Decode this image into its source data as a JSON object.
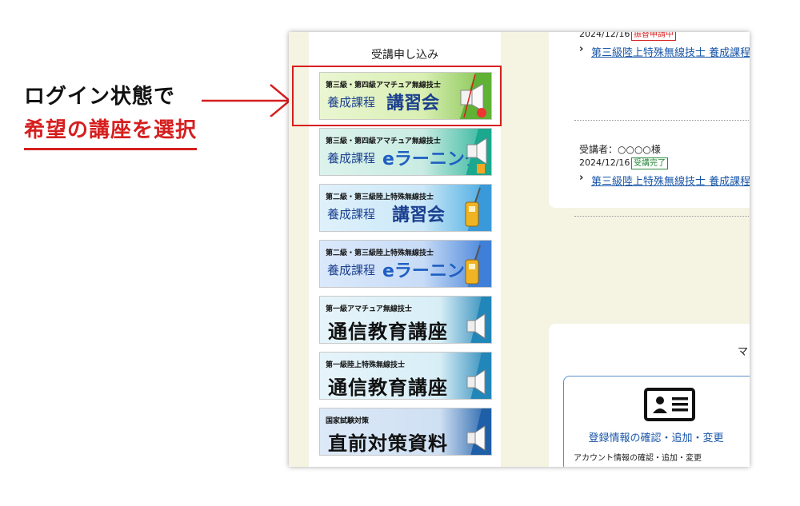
{
  "annotation": {
    "line1": "ログイン状態で",
    "line2": "希望の講座を選択",
    "accent_color": "#d61f1f"
  },
  "sidebar": {
    "title": "受講申し込み",
    "banners": [
      {
        "top": "第三級・第四級アマチュア無線技士",
        "sub": "養成課程",
        "main": "講習会",
        "icon": "megaphone-icon"
      },
      {
        "top": "第三級・第四級アマチュア無線技士",
        "sub": "養成課程",
        "main": "eラーニング",
        "icon": "megaphone-icon"
      },
      {
        "top": "第二級・第三級陸上特殊無線技士",
        "sub": "養成課程",
        "main": "講習会",
        "icon": "radio-icon"
      },
      {
        "top": "第二級・第三級陸上特殊無線技士",
        "sub": "養成課程",
        "main": "eラーニング",
        "icon": "radio-icon"
      },
      {
        "top": "第一級アマチュア無線技士",
        "main": "通信教育講座",
        "icon": "megaphone-icon"
      },
      {
        "top": "第一級陸上特殊無線技士",
        "main": "通信教育講座",
        "icon": "megaphone-icon"
      },
      {
        "top": "国家試験対策",
        "main": "直前対策資料",
        "icon": "megaphone-icon"
      }
    ]
  },
  "applications": {
    "items": [
      {
        "date": "2024/12/16",
        "status": "振替申請中",
        "link": "第三級陸上特殊無線技士 養成課程"
      },
      {
        "who": "受講者：○○○○様",
        "date": "2024/12/16",
        "status": "受講完了",
        "link": "第三級陸上特殊無線技士 養成課程"
      }
    ]
  },
  "mypage": {
    "heading": "マ",
    "card_link": "登録情報の確認・追加・変更",
    "card_desc": "アカウント情報の確認・追加・変更",
    "icon": "id-card-icon"
  }
}
